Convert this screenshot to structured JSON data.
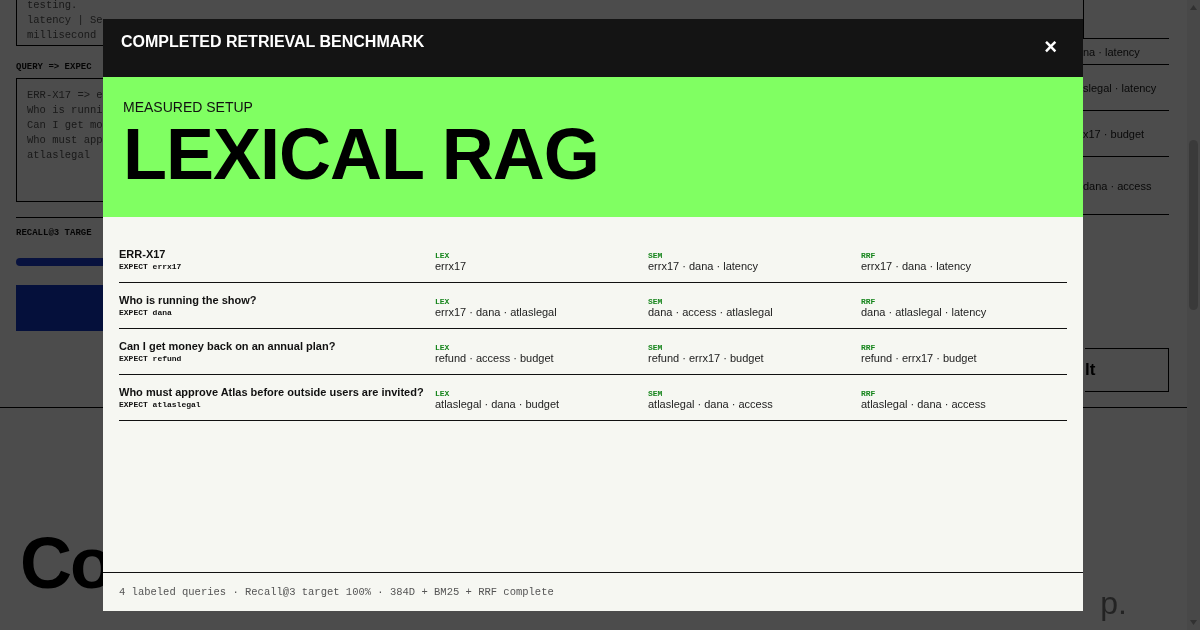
{
  "background": {
    "notes_lines": [
      "testing.",
      "latency | Se",
      "millisecond"
    ],
    "query_label": "QUERY => EXPEC",
    "query_lines": [
      "ERR-X17 => e",
      "Who is runni",
      "Can I get mo",
      "Who must app",
      "atlaslegal"
    ],
    "recall_label": "RECALL@3 TARGE",
    "recall_progress": {
      "level": 1
    },
    "result_fragments": [
      "na · latency",
      "slegal · latency",
      "x17 · budget",
      "dana · access"
    ],
    "button_fragment": "lt",
    "heading": "Co",
    "subtitle_fragment": "p."
  },
  "modal": {
    "title": "COMPLETED RETRIEVAL BENCHMARK",
    "close": "×",
    "eyebrow": "MEASURED SETUP",
    "headline": "LEXICAL RAG",
    "rows": [
      {
        "query": "ERR-X17",
        "expect": "EXPECT errx17",
        "results": [
          {
            "method": "LEX",
            "hits": "errx17"
          },
          {
            "method": "SEM",
            "hits": "errx17 · dana · latency"
          },
          {
            "method": "RRF",
            "hits": "errx17 · dana · latency"
          }
        ]
      },
      {
        "query": "Who is running the show?",
        "expect": "EXPECT dana",
        "results": [
          {
            "method": "LEX",
            "hits": "errx17 · dana · atlaslegal"
          },
          {
            "method": "SEM",
            "hits": "dana · access · atlaslegal"
          },
          {
            "method": "RRF",
            "hits": "dana · atlaslegal · latency"
          }
        ]
      },
      {
        "query": "Can I get money back on an annual plan?",
        "expect": "EXPECT refund",
        "results": [
          {
            "method": "LEX",
            "hits": "refund · access · budget"
          },
          {
            "method": "SEM",
            "hits": "refund · errx17 · budget"
          },
          {
            "method": "RRF",
            "hits": "refund · errx17 · budget"
          }
        ]
      },
      {
        "query": "Who must approve Atlas before outside users are invited?",
        "expect": "EXPECT atlaslegal",
        "results": [
          {
            "method": "LEX",
            "hits": "atlaslegal · dana · budget"
          },
          {
            "method": "SEM",
            "hits": "atlaslegal · dana · access"
          },
          {
            "method": "RRF",
            "hits": "atlaslegal · dana · access"
          }
        ]
      }
    ],
    "footer": "4 labeled queries · Recall@3 target 100% · 384D + BM25 + RRF complete"
  }
}
